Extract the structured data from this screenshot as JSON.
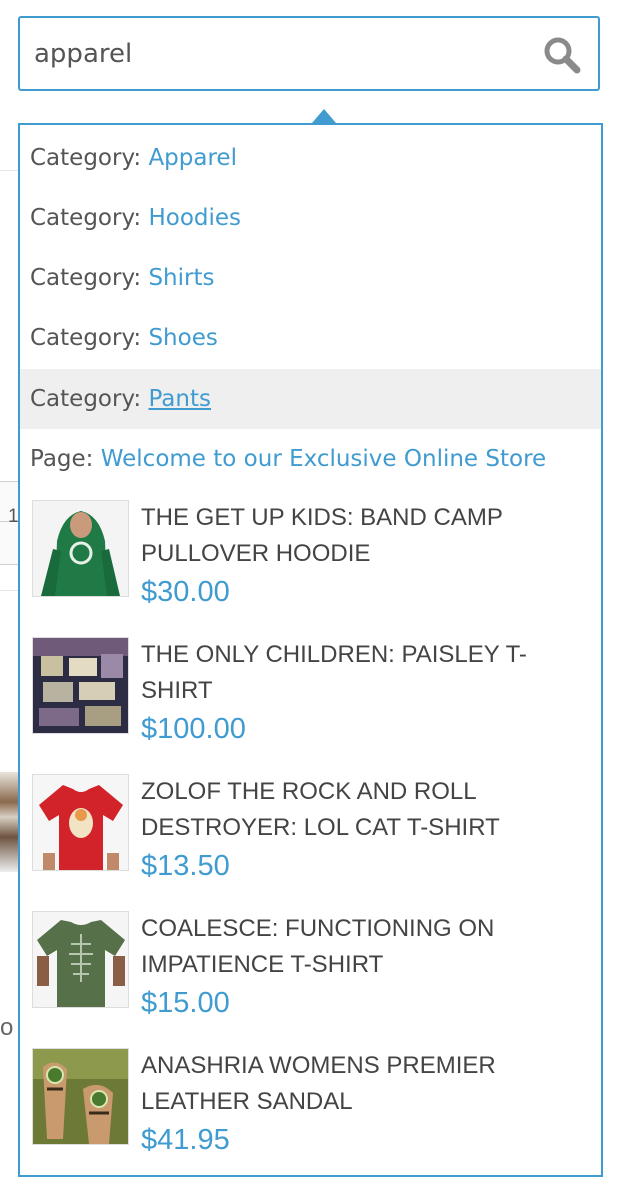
{
  "search": {
    "value": "apparel",
    "icon": "search-icon"
  },
  "suggestions": [
    {
      "kind": "Category: ",
      "label": "Apparel"
    },
    {
      "kind": "Category: ",
      "label": "Hoodies"
    },
    {
      "kind": "Category: ",
      "label": "Shirts"
    },
    {
      "kind": "Category: ",
      "label": "Shoes"
    },
    {
      "kind": "Category: ",
      "label": "Pants",
      "highlighted": true
    },
    {
      "kind": "Page: ",
      "label": "Welcome to our Exclusive Online Store"
    }
  ],
  "products": [
    {
      "name": "THE GET UP KIDS: BAND CAMP PULLOVER HOODIE",
      "price": "$30.00",
      "image": "green-hoodie"
    },
    {
      "name": "THE ONLY CHILDREN: PAISLEY T-SHIRT",
      "price": "$100.00",
      "image": "paisley-tshirt"
    },
    {
      "name": "ZOLOF THE ROCK AND ROLL DESTROYER: LOL CAT T-SHIRT",
      "price": "$13.50",
      "image": "red-tshirt"
    },
    {
      "name": "COALESCE: FUNCTIONING ON IMPATIENCE T-SHIRT",
      "price": "$15.00",
      "image": "green-tshirt"
    },
    {
      "name": "ANASHRIA WOMENS PREMIER LEATHER SANDAL",
      "price": "$41.95",
      "image": "sandals"
    }
  ],
  "background": {
    "qty_fragment": "1",
    "text_fragment": "o"
  },
  "colors": {
    "accent": "#3f9bd0",
    "highlight_row": "#efefef",
    "text": "#555555"
  }
}
